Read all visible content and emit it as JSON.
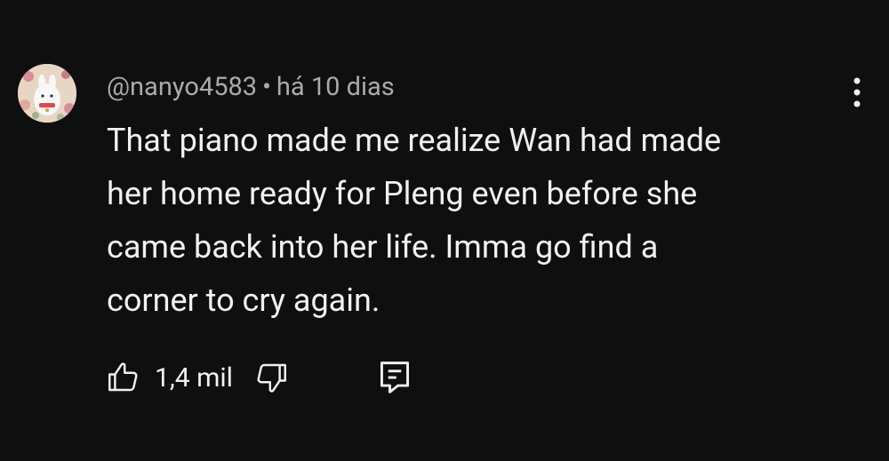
{
  "comment": {
    "author": "@nanyo4583",
    "separator": "•",
    "time": "há 10 dias",
    "text_lines": [
      "That piano made me realize Wan had made",
      "her home ready for Pleng even before she",
      "came back into her life. Imma go find a",
      "corner to cry again."
    ],
    "like_count": "1,4 mil"
  },
  "icons": {
    "menu": "more-vert-icon",
    "like": "thumb-up-icon",
    "dislike": "thumb-down-icon",
    "reply": "comment-icon"
  },
  "colors": {
    "background": "#0f0f0f",
    "text": "#f1f1f1",
    "meta": "#aaaaaa"
  }
}
